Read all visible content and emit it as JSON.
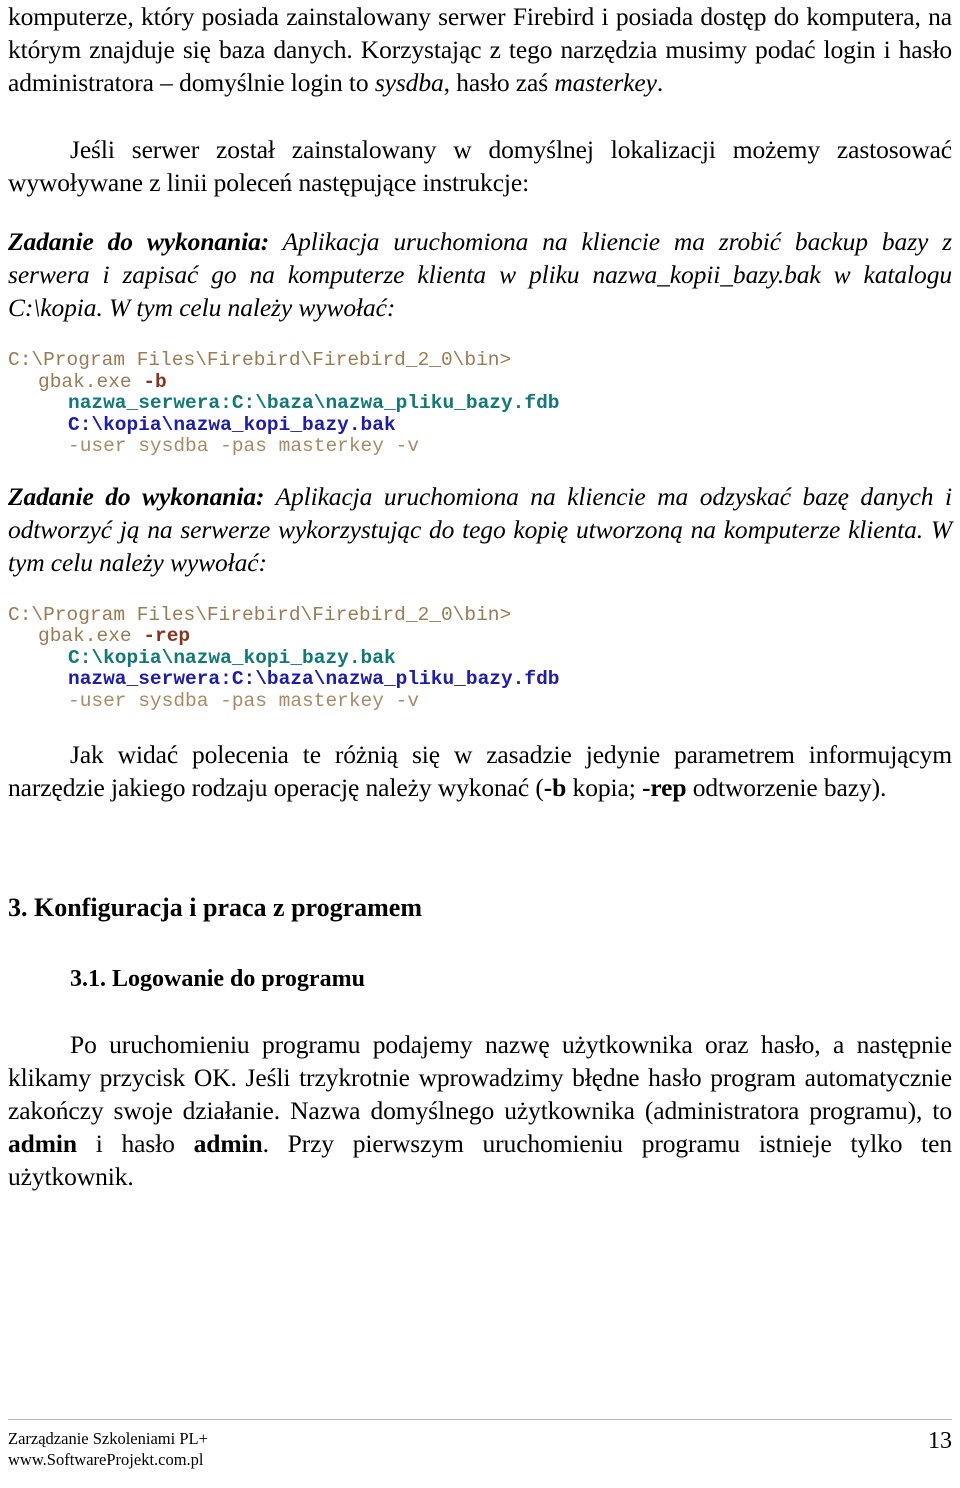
{
  "document": {
    "language": "pl",
    "page_number": "13"
  },
  "body": {
    "para_intro_line1": "komputerze, który posiada zainstalowany serwer Firebird i posiada dostęp do komputera, na",
    "para_intro_line2_a": "którym znajduje się baza danych. Korzystając z tego narzędzia musimy podać login i hasło",
    "para_intro_line3_a": "administratora – domyślnie login to ",
    "para_intro_italic_1": "sysdba",
    "para_intro_line3_b": ", hasło zaś ",
    "para_intro_italic_2": "masterkey",
    "para_intro_line3_c": ".",
    "para_default_location": "Jeśli serwer został zainstalowany w domyślnej lokalizacji możemy zastosować wywoływane z linii poleceń następujące instrukcje:",
    "task1_label": "Zadanie do wykonania:",
    "task1_text": " Aplikacja uruchomiona na kliencie ma zrobić backup bazy z serwera i zapisać go na komputerze klienta w pliku nazwa_kopii_bazy.bak w katalogu C:\\kopia. W tym celu należy wywołać:",
    "task2_label": "Zadanie do wykonania:",
    "task2_text": " Aplikacja uruchomiona na kliencie ma odzyskać bazę danych i odtworzyć ją na serwerze wykorzystując do tego kopię utworzoną na komputerze klienta. W tym celu należy wywołać:",
    "para_summary_a": "Jak widać polecenia te różnią się w zasadzie jedynie parametrem informującym narzędzie jakiego rodzaju operację należy wykonać (",
    "para_summary_b": "-b",
    "para_summary_c": " kopia;   ",
    "para_summary_d": "-rep",
    "para_summary_e": " odtworzenie bazy)."
  },
  "code_block_backup": {
    "line1": "C:\\Program Files\\Firebird\\Firebird_2_0\\bin>",
    "line2_cmd": "gbak.exe ",
    "line2_switch": "-b",
    "line3": "nazwa_serwera:C:\\baza\\nazwa_pliku_bazy.fdb",
    "line4": "C:\\kopia\\nazwa_kopi_bazy.bak",
    "line5": "-user sysdba -pas masterkey -v"
  },
  "code_block_restore": {
    "line1": "C:\\Program Files\\Firebird\\Firebird_2_0\\bin>",
    "line2_cmd": "gbak.exe ",
    "line2_switch": "-rep",
    "line3": "C:\\kopia\\nazwa_kopi_bazy.bak",
    "line4": "nazwa_serwera:C:\\baza\\nazwa_pliku_bazy.fdb",
    "line5": "-user sysdba -pas masterkey -v"
  },
  "headings": {
    "section_3": "3. Konfiguracja i praca z programem",
    "section_3_1": "3.1. Logowanie do programu"
  },
  "login_section": {
    "para_a": "Po uruchomieniu programu podajemy nazwę użytkownika oraz hasło, a następnie klikamy przycisk OK. Jeśli trzykrotnie wprowadzimy błędne hasło program automatycznie zakończy swoje działanie. Nazwa domyślnego użytkownika (administratora programu), to ",
    "bold_user": "admin",
    "para_b": " i hasło ",
    "bold_pass": "admin",
    "para_c": ". Przy pierwszym uruchomieniu programu istnieje tylko ten użytkownik."
  },
  "footer": {
    "line1": "Zarządzanie Szkoleniami PL+",
    "line2": "www.SoftwareProjekt.com.pl",
    "page_number": "13"
  },
  "colors": {
    "prompt_tan": "#9b7b52",
    "switch_dark_red": "#8a3420",
    "path_teal": "#11797a",
    "path_blue": "#1c1cb0",
    "args_tan": "#a98a63",
    "footer_rule": "#b9b9b9"
  }
}
